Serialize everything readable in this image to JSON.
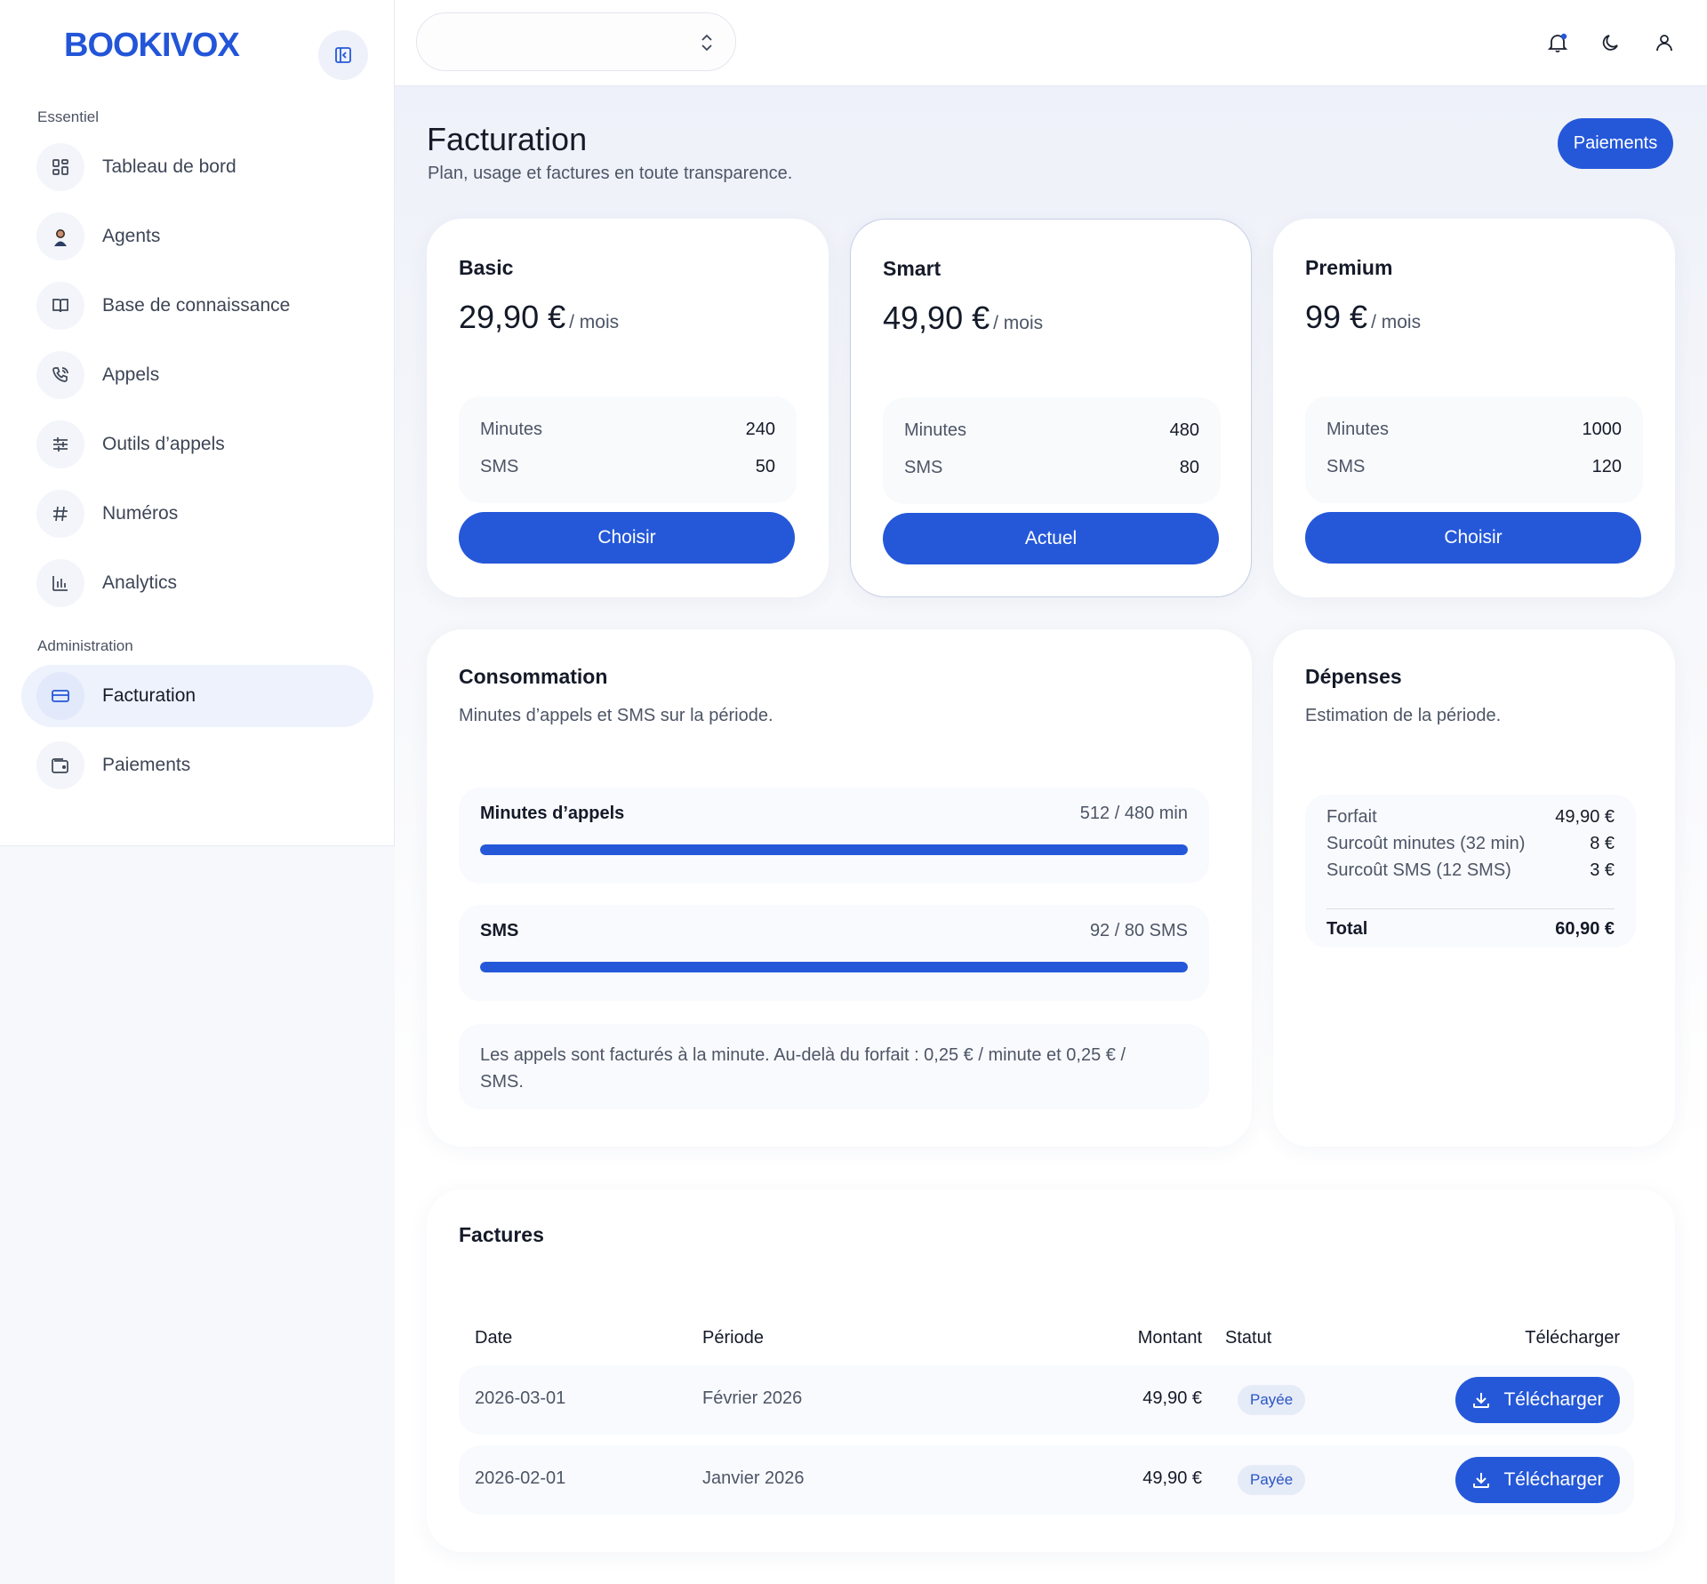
{
  "app": {
    "logo": "BOOKIVOX"
  },
  "sidebar": {
    "section_essentiel": "Essentiel",
    "section_admin": "Administration",
    "items": [
      {
        "label": "Tableau de bord",
        "icon": "dashboard-icon"
      },
      {
        "label": "Agents",
        "icon": "agent-avatar"
      },
      {
        "label": "Base de connaissance",
        "icon": "book-icon"
      },
      {
        "label": "Appels",
        "icon": "phone-icon"
      },
      {
        "label": "Outils d’appels",
        "icon": "sliders-icon"
      },
      {
        "label": "Numéros",
        "icon": "hash-icon"
      },
      {
        "label": "Analytics",
        "icon": "bar-chart-icon"
      },
      {
        "label": "Facturation",
        "icon": "credit-card-icon",
        "active": true
      },
      {
        "label": "Paiements",
        "icon": "wallet-icon"
      }
    ]
  },
  "header": {
    "workspace_select_value": "",
    "icons": [
      "bell-icon",
      "moon-icon",
      "user-icon"
    ]
  },
  "page": {
    "title": "Facturation",
    "subtitle": "Plan, usage et factures en toute transparence.",
    "payments_button": "Paiements"
  },
  "plans": [
    {
      "name": "Basic",
      "price": "29,90 €",
      "per": "/ mois",
      "minutes_label": "Minutes",
      "minutes": "240",
      "sms_label": "SMS",
      "sms": "50",
      "button": "Choisir",
      "current": false
    },
    {
      "name": "Smart",
      "price": "49,90 €",
      "per": "/ mois",
      "minutes_label": "Minutes",
      "minutes": "480",
      "sms_label": "SMS",
      "sms": "80",
      "button": "Actuel",
      "current": true
    },
    {
      "name": "Premium",
      "price": "99 €",
      "per": "/ mois",
      "minutes_label": "Minutes",
      "minutes": "1000",
      "sms_label": "SMS",
      "sms": "120",
      "button": "Choisir",
      "current": false
    }
  ],
  "consumption": {
    "title": "Consommation",
    "subtitle": "Minutes d’appels et SMS sur la période.",
    "minutes": {
      "label": "Minutes d’appels",
      "value": "512 / 480 min",
      "fill": 1.0
    },
    "sms": {
      "label": "SMS",
      "value": "92 / 80 SMS",
      "fill": 1.0
    },
    "note": "Les appels sont facturés à la minute. Au-delà du forfait : 0,25 € / minute et 0,25 € / SMS."
  },
  "expenses": {
    "title": "Dépenses",
    "subtitle": "Estimation de la période.",
    "rows": [
      {
        "label": "Forfait",
        "value": "49,90 €"
      },
      {
        "label": "Surcoût minutes (32 min)",
        "value": "8 €"
      },
      {
        "label": "Surcoût SMS (12 SMS)",
        "value": "3 €"
      }
    ],
    "total_label": "Total",
    "total_value": "60,90 €"
  },
  "invoices": {
    "title": "Factures",
    "columns": [
      "Date",
      "Période",
      "Montant",
      "Statut",
      "Télécharger"
    ],
    "rows": [
      {
        "date": "2026-03-01",
        "period": "Février 2026",
        "amount": "49,90 €",
        "status": "Payée",
        "download": "Télécharger"
      },
      {
        "date": "2026-02-01",
        "period": "Janvier 2026",
        "amount": "49,90 €",
        "status": "Payée",
        "download": "Télécharger"
      }
    ]
  },
  "colors": {
    "accent": "#2558d9",
    "logo": "#2255d8",
    "badge_bg": "#e6ebf8"
  }
}
